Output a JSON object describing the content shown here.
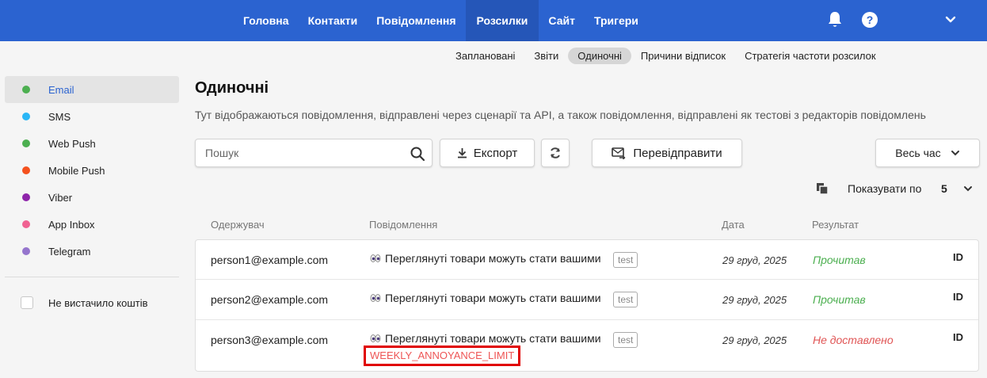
{
  "topnav": {
    "items": [
      {
        "label": "Головна"
      },
      {
        "label": "Контакти"
      },
      {
        "label": "Повідомлення"
      },
      {
        "label": "Розсилки",
        "active": true
      },
      {
        "label": "Сайт"
      },
      {
        "label": "Тригери"
      }
    ],
    "help_label": "?",
    "bar_color": "#2b63d0"
  },
  "subtabs": [
    {
      "label": "Заплановані"
    },
    {
      "label": "Звіти"
    },
    {
      "label": "Одиночні",
      "active": true
    },
    {
      "label": "Причини відписок"
    },
    {
      "label": "Стратегія частоти розсилок"
    }
  ],
  "sidebar": {
    "items": [
      {
        "label": "Email",
        "color": "#4caf50",
        "active": true
      },
      {
        "label": "SMS",
        "color": "#29b6f6"
      },
      {
        "label": "Web Push",
        "color": "#4caf50"
      },
      {
        "label": "Mobile Push",
        "color": "#f4511e"
      },
      {
        "label": "Viber",
        "color": "#8e24aa"
      },
      {
        "label": "App Inbox",
        "color": "#f06292"
      },
      {
        "label": "Telegram",
        "color": "#9575cd"
      }
    ],
    "filter_label": "Не вистачило коштів"
  },
  "main": {
    "title": "Одиночні",
    "description": "Тут відображаються повідомлення, відправлені через сценарії та API, а також повідомлення, відправлені як тестові з редакторів повідомлень",
    "search_placeholder": "Пошук",
    "export_label": "Експорт",
    "resend_label": "Перевідправити",
    "period_label": "Весь час",
    "per_page_label": "Показувати по",
    "per_page_value": "5"
  },
  "table": {
    "columns": [
      "Одержувач",
      "Повідомлення",
      "Дата",
      "Результат"
    ],
    "rows": [
      {
        "recipient": "person1@example.com",
        "message": "Переглянуті товари можуть стати вашими",
        "tag": "test",
        "date": "29 груд, 2025",
        "result": "Прочитав",
        "result_color": "#4caf50",
        "id": "ID"
      },
      {
        "recipient": "person2@example.com",
        "message": "Переглянуті товари можуть стати вашими",
        "tag": "test",
        "date": "29 груд, 2025",
        "result": "Прочитав",
        "result_color": "#4caf50",
        "id": "ID"
      },
      {
        "recipient": "person3@example.com",
        "message": "Переглянуті товари можуть стати вашими",
        "tag": "test",
        "date": "29 груд, 2025",
        "result": "Не доставлено",
        "result_color": "#e05555",
        "id": "ID",
        "error": "WEEKLY_ANNOYANCE_LIMIT"
      }
    ]
  }
}
